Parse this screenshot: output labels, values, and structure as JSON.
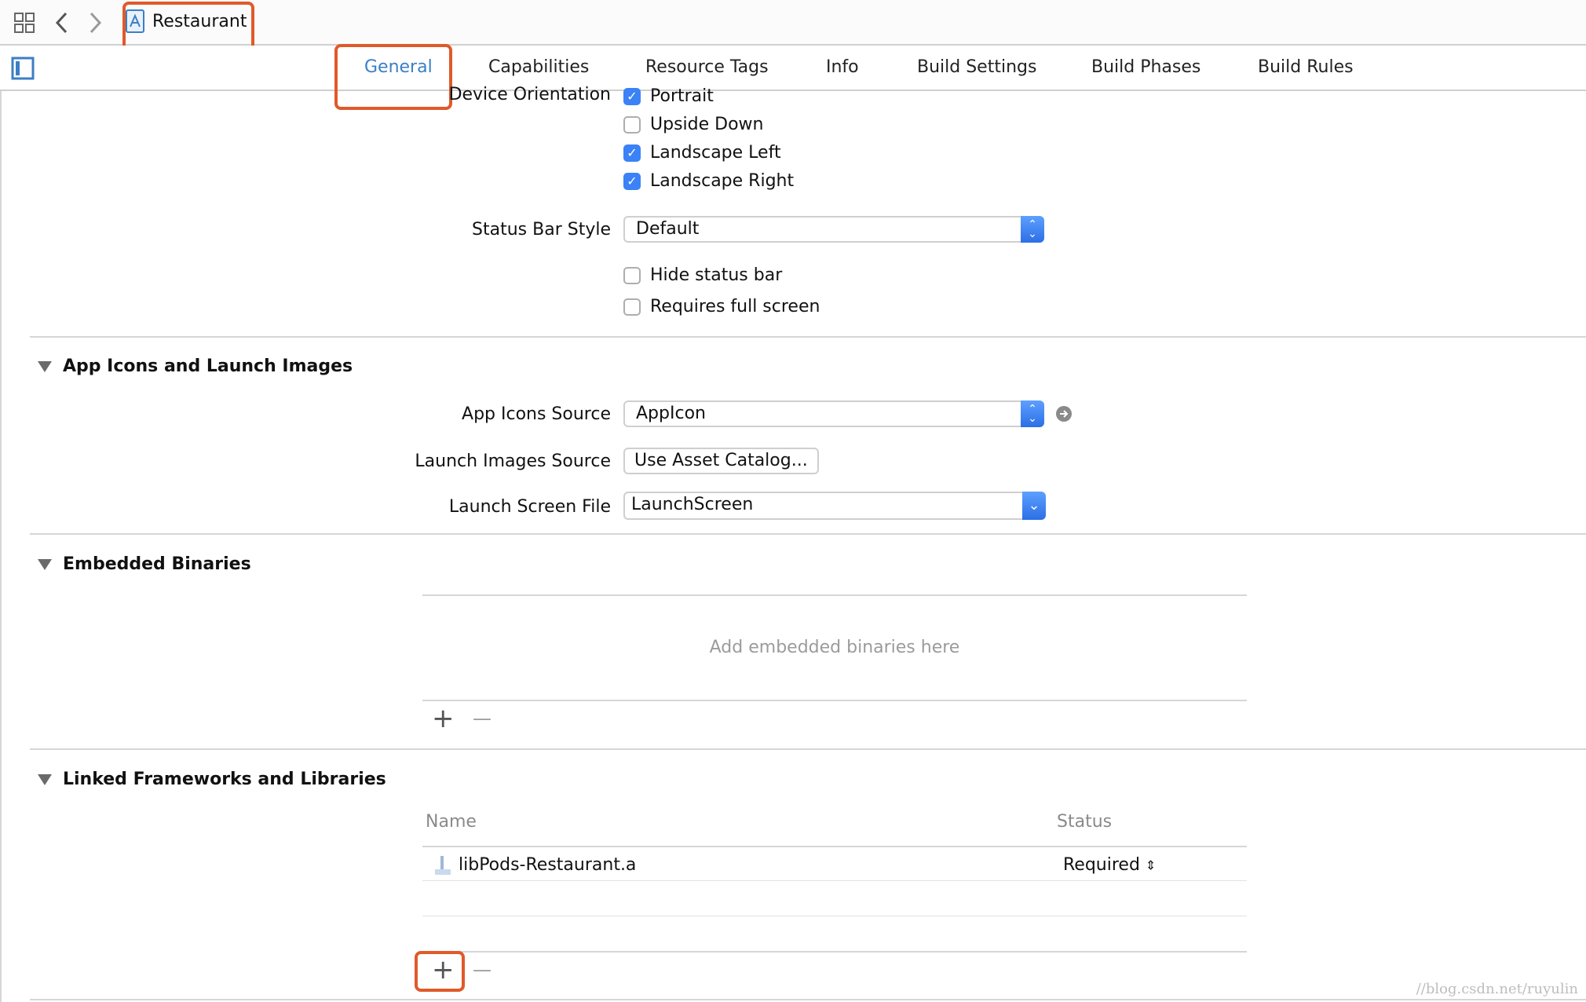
{
  "toolbar": {
    "project_name": "Restaurant"
  },
  "tabs": [
    {
      "label": "General",
      "active": true
    },
    {
      "label": "Capabilities",
      "active": false
    },
    {
      "label": "Resource Tags",
      "active": false
    },
    {
      "label": "Info",
      "active": false
    },
    {
      "label": "Build Settings",
      "active": false
    },
    {
      "label": "Build Phases",
      "active": false
    },
    {
      "label": "Build Rules",
      "active": false
    }
  ],
  "deployment": {
    "device_orientation_label": "Device Orientation",
    "orientations": [
      {
        "label": "Portrait",
        "checked": true
      },
      {
        "label": "Upside Down",
        "checked": false
      },
      {
        "label": "Landscape Left",
        "checked": true
      },
      {
        "label": "Landscape Right",
        "checked": true
      }
    ],
    "status_bar_style_label": "Status Bar Style",
    "status_bar_style_value": "Default",
    "hide_status_bar": {
      "label": "Hide status bar",
      "checked": false
    },
    "requires_full_screen": {
      "label": "Requires full screen",
      "checked": false
    }
  },
  "app_icons": {
    "title": "App Icons and Launch Images",
    "icons_source_label": "App Icons Source",
    "icons_source_value": "AppIcon",
    "launch_images_label": "Launch Images Source",
    "launch_images_button": "Use Asset Catalog...",
    "launch_screen_label": "Launch Screen File",
    "launch_screen_value": "LaunchScreen"
  },
  "embedded": {
    "title": "Embedded Binaries",
    "placeholder": "Add embedded binaries here",
    "add": "+",
    "remove": "—"
  },
  "linked": {
    "title": "Linked Frameworks and Libraries",
    "col_name": "Name",
    "col_status": "Status",
    "rows": [
      {
        "name": "libPods-Restaurant.a",
        "status": "Required"
      }
    ],
    "add": "+",
    "remove": "—"
  },
  "watermark": "//blog.csdn.net/ruyulin",
  "colors": {
    "accent": "#3b7fc4",
    "highlight": "#e05a2a",
    "checkbox_on": "#3b82f6"
  }
}
